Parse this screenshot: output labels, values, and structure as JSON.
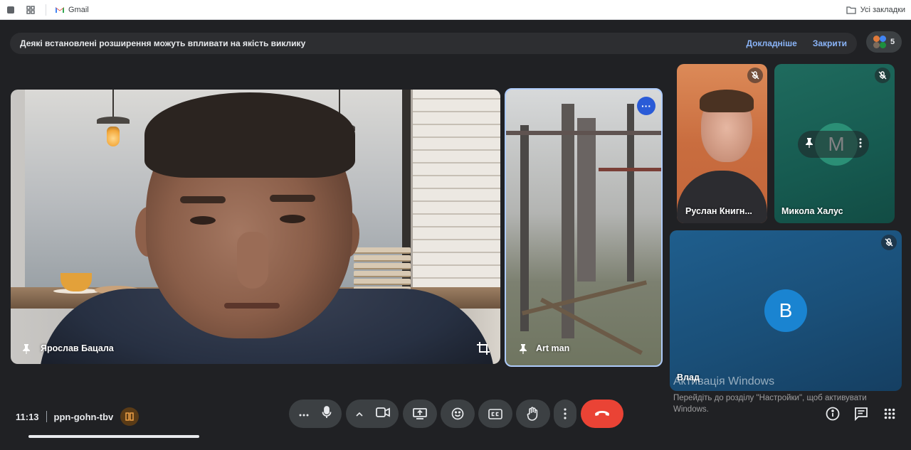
{
  "browser": {
    "bookmark_gmail": "Gmail",
    "all_bookmarks": "Усі закладки"
  },
  "banner": {
    "message": "Деякі встановлені розширення можуть впливати на якість виклику",
    "learn_more": "Докладніше",
    "close": "Закрити"
  },
  "participants_count": "5",
  "tiles": {
    "main": {
      "name": "Ярослав Бацала"
    },
    "art": {
      "name": "Art man"
    },
    "ruslan": {
      "name": "Руслан Книгн..."
    },
    "mykola": {
      "name": "Микола Халус",
      "initial": "M"
    },
    "vlad": {
      "name": "Влад",
      "initial": "B"
    }
  },
  "windows_activation": {
    "title": "Активація Windows",
    "subtitle": "Перейдіть до розділу \"Настройки\", щоб активувати Windows."
  },
  "meeting": {
    "time": "11:13",
    "code": "ppn-gohn-tbv"
  },
  "icons": {
    "mic": "mic-icon",
    "camera": "camera-icon",
    "present": "present-screen-icon",
    "emoji": "emoji-icon",
    "captions": "captions-icon",
    "raise_hand": "hand-icon",
    "more": "more-vert-icon",
    "end_call": "call-end-icon",
    "info": "info-icon",
    "chat": "chat-icon",
    "activities": "apps-icon"
  },
  "colors": {
    "end_call": "#ea4335",
    "accent_link": "#8ab4f8",
    "active_tile_border": "#aecbfa"
  }
}
